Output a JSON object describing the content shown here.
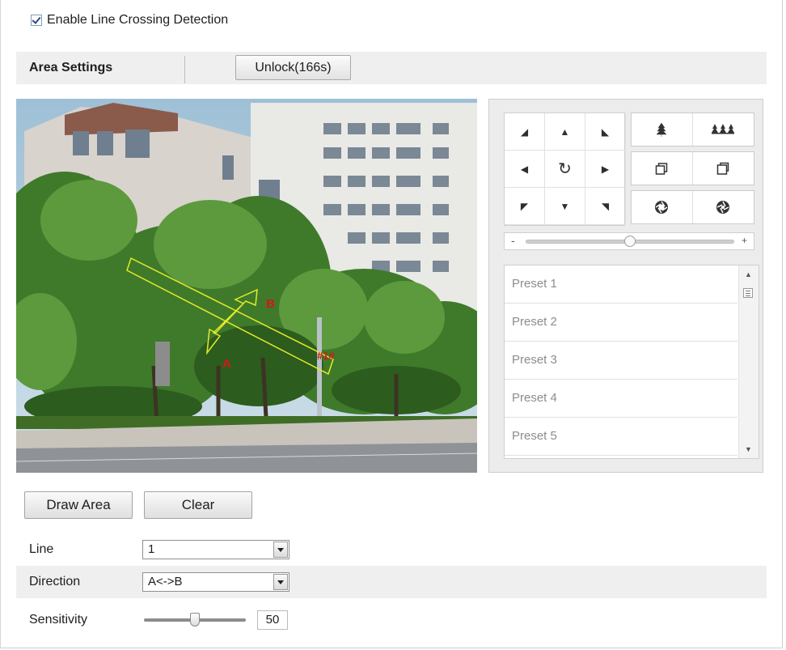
{
  "enable_checkbox": {
    "label": "Enable Line Crossing Detection",
    "checked": true
  },
  "area_settings": {
    "title": "Area Settings",
    "unlock_button": "Unlock(166s)"
  },
  "video_overlay": {
    "label_a": "A",
    "label_b": "B",
    "line_id": "#1#"
  },
  "ptz": {
    "direction_icons": [
      "arrow-up-left-icon",
      "arrow-up-icon",
      "arrow-up-right-icon",
      "arrow-left-icon",
      "auto-rotate-icon",
      "arrow-right-icon",
      "arrow-down-left-icon",
      "arrow-down-icon",
      "arrow-down-right-icon"
    ],
    "zoom_icons": [
      "zoom-in-icon",
      "zoom-out-icon"
    ],
    "focus_icons": [
      "focus-near-icon",
      "focus-far-icon"
    ],
    "iris_icons": [
      "iris-open-icon",
      "iris-close-icon"
    ],
    "speed": {
      "minus": "-",
      "plus": "+",
      "value": 0.5
    },
    "presets": [
      "Preset 1",
      "Preset 2",
      "Preset 3",
      "Preset 4",
      "Preset 5"
    ]
  },
  "actions": {
    "draw_area": "Draw Area",
    "clear": "Clear"
  },
  "form": {
    "line": {
      "label": "Line",
      "value": "1"
    },
    "direction": {
      "label": "Direction",
      "value": "A<->B"
    },
    "sensitivity": {
      "label": "Sensitivity",
      "value": "50",
      "fraction": 0.5
    }
  }
}
